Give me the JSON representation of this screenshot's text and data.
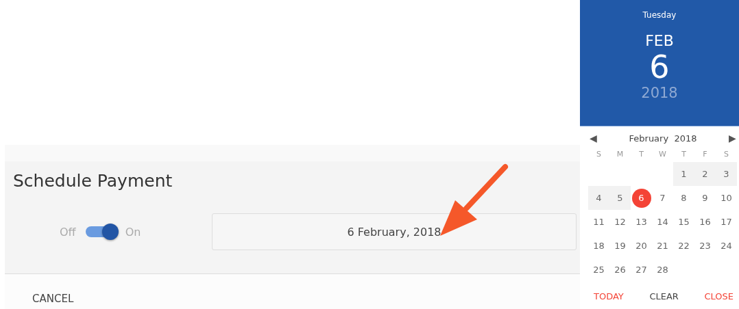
{
  "dialog": {
    "title": "Schedule Payment",
    "toggle": {
      "off_label": "Off",
      "on_label": "On",
      "on": true
    },
    "date_field": {
      "value": "6 February, 2018"
    },
    "cancel": "CANCEL"
  },
  "annotation": {
    "kind": "arrow"
  },
  "datepicker": {
    "weekday": "Tuesday",
    "month_short": "FEB",
    "day": "6",
    "year": "2018",
    "month_title": "February  2018",
    "prev": "◀",
    "next": "▶",
    "weekday_heads": [
      "S",
      "M",
      "T",
      "W",
      "T",
      "F",
      "S"
    ],
    "weeks": [
      {
        "right_aligned": true,
        "days": [
          {
            "day": "1",
            "highlighted": true,
            "selected": false
          },
          {
            "day": "2",
            "highlighted": true,
            "selected": false
          },
          {
            "day": "3",
            "highlighted": true,
            "selected": false
          }
        ]
      },
      {
        "right_aligned": false,
        "days": [
          {
            "day": "4",
            "highlighted": true,
            "selected": false
          },
          {
            "day": "5",
            "highlighted": true,
            "selected": false
          },
          {
            "day": "6",
            "highlighted": false,
            "selected": true
          },
          {
            "day": "7",
            "highlighted": false,
            "selected": false
          },
          {
            "day": "8",
            "highlighted": false,
            "selected": false
          },
          {
            "day": "9",
            "highlighted": false,
            "selected": false
          },
          {
            "day": "10",
            "highlighted": false,
            "selected": false
          }
        ]
      },
      {
        "right_aligned": false,
        "days": [
          {
            "day": "11",
            "highlighted": false,
            "selected": false
          },
          {
            "day": "12",
            "highlighted": false,
            "selected": false
          },
          {
            "day": "13",
            "highlighted": false,
            "selected": false
          },
          {
            "day": "14",
            "highlighted": false,
            "selected": false
          },
          {
            "day": "15",
            "highlighted": false,
            "selected": false
          },
          {
            "day": "16",
            "highlighted": false,
            "selected": false
          },
          {
            "day": "17",
            "highlighted": false,
            "selected": false
          }
        ]
      },
      {
        "right_aligned": false,
        "days": [
          {
            "day": "18",
            "highlighted": false,
            "selected": false
          },
          {
            "day": "19",
            "highlighted": false,
            "selected": false
          },
          {
            "day": "20",
            "highlighted": false,
            "selected": false
          },
          {
            "day": "21",
            "highlighted": false,
            "selected": false
          },
          {
            "day": "22",
            "highlighted": false,
            "selected": false
          },
          {
            "day": "23",
            "highlighted": false,
            "selected": false
          },
          {
            "day": "24",
            "highlighted": false,
            "selected": false
          }
        ]
      },
      {
        "right_aligned": false,
        "days": [
          {
            "day": "25",
            "highlighted": false,
            "selected": false
          },
          {
            "day": "26",
            "highlighted": false,
            "selected": false
          },
          {
            "day": "27",
            "highlighted": false,
            "selected": false
          },
          {
            "day": "28",
            "highlighted": false,
            "selected": false
          }
        ]
      }
    ],
    "buttons": [
      "TODAY",
      "CLEAR",
      "CLOSE"
    ]
  }
}
